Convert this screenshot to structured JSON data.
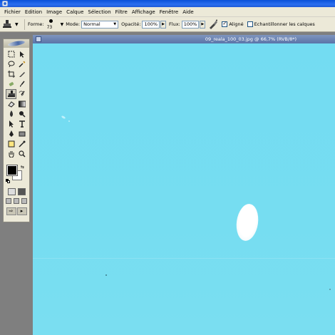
{
  "menubar": {
    "items": [
      "Fichier",
      "Edition",
      "Image",
      "Calque",
      "Sélection",
      "Filtre",
      "Affichage",
      "Fenêtre",
      "Aide"
    ]
  },
  "options": {
    "forme_label": "Forme:",
    "brush_size": "73",
    "mode_label": "Mode:",
    "mode_value": "Normal",
    "opacite_label": "Opacité:",
    "opacite_value": "100%",
    "flux_label": "Flux:",
    "flux_value": "100%",
    "aligne_label": "Aligné",
    "aligne_checked": true,
    "echantillonner_label": "Echantillonner les calques",
    "echantillonner_checked": false
  },
  "document": {
    "title": "09_reala_100_03.jpg @ 66,7% (RVB/8*)",
    "canvas_color": "#75dcf1"
  },
  "colors": {
    "foreground": "#000000",
    "background": "#ffffff"
  },
  "toolbox": {
    "tools": [
      "marquee-icon",
      "move-icon",
      "lasso-icon",
      "magic-wand-icon",
      "crop-icon",
      "slice-icon",
      "healing-brush-icon",
      "brush-icon",
      "clone-stamp-icon",
      "history-brush-icon",
      "eraser-icon",
      "gradient-icon",
      "blur-icon",
      "dodge-icon",
      "path-select-icon",
      "type-icon",
      "pen-icon",
      "shape-icon",
      "notes-icon",
      "eyedropper-icon",
      "hand-icon",
      "zoom-icon"
    ],
    "active_tool": "clone-stamp-icon"
  }
}
